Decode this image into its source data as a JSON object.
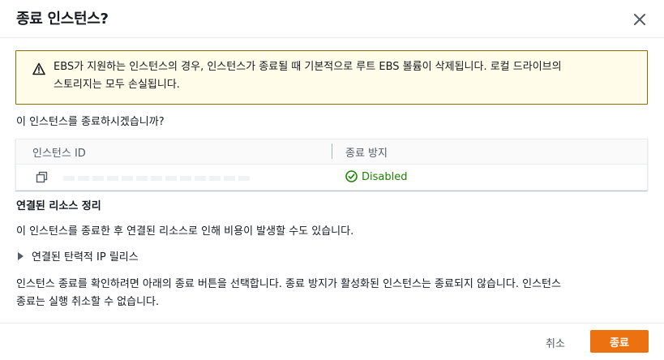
{
  "dialog": {
    "title": "종료 인스턴스?",
    "close_icon": "close-icon"
  },
  "warning": {
    "icon": "warning-icon",
    "text_line1": "EBS가 지원하는 인스턴스의 경우, 인스턴스가 종료될 때 기본적으로 루트 EBS 볼륨이 삭제됩니다. 로컬 드라이브의",
    "text_line2": "스토리지는 모두 손실됩니다."
  },
  "question": "이 인스턴스를 종료하시겠습니까?",
  "table": {
    "columns": [
      "인스턴스 ID",
      "종료 방지"
    ],
    "rows": [
      {
        "instance_id_icon": "copy-icon",
        "termination_protection": "Disabled",
        "status_icon": "check-circle-icon"
      }
    ]
  },
  "cleanup": {
    "title": "연결된 리소스 정리",
    "description": "이 인스턴스를 종료한 후 연결된 리소스로 인해 비용이 발생할 수도 있습니다.",
    "expander_label": "연결된 탄력적 IP 릴리스"
  },
  "confirm": {
    "text_line1": "인스턴스 종료를 확인하려면 아래의 종료 버튼을 선택합니다. 종료 방지가 활성화된 인스턴스는 종료되지 않습니다. 인스턴스",
    "text_line2": "종료는 실행 취소할 수 없습니다."
  },
  "footer": {
    "cancel_label": "취소",
    "terminate_label": "종료"
  },
  "colors": {
    "primary_button": "#ec7211",
    "warning_border": "#8c6e00",
    "warning_bg": "#fffce9",
    "success": "#1d8102"
  }
}
